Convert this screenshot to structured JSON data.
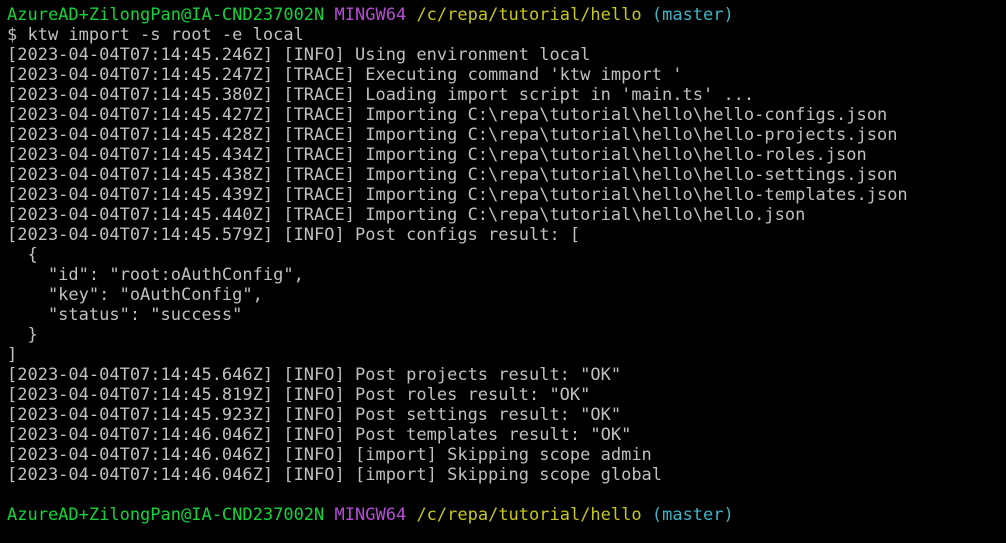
{
  "prompt": {
    "user_host": "AzureAD+ZilongPan@IA-CND237002N",
    "env": "MINGW64",
    "path": "/c/repa/tutorial/hello",
    "branch": "(master)"
  },
  "command": "$ ktw import -s root -e local",
  "output_lines": [
    "[2023-04-04T07:14:45.246Z] [INFO] Using environment local",
    "[2023-04-04T07:14:45.247Z] [TRACE] Executing command 'ktw import '",
    "[2023-04-04T07:14:45.380Z] [TRACE] Loading import script in 'main.ts' ...",
    "[2023-04-04T07:14:45.427Z] [TRACE] Importing C:\\repa\\tutorial\\hello\\hello-configs.json",
    "[2023-04-04T07:14:45.428Z] [TRACE] Importing C:\\repa\\tutorial\\hello\\hello-projects.json",
    "[2023-04-04T07:14:45.434Z] [TRACE] Importing C:\\repa\\tutorial\\hello\\hello-roles.json",
    "[2023-04-04T07:14:45.438Z] [TRACE] Importing C:\\repa\\tutorial\\hello\\hello-settings.json",
    "[2023-04-04T07:14:45.439Z] [TRACE] Importing C:\\repa\\tutorial\\hello\\hello-templates.json",
    "[2023-04-04T07:14:45.440Z] [TRACE] Importing C:\\repa\\tutorial\\hello\\hello.json",
    "[2023-04-04T07:14:45.579Z] [INFO] Post configs result: [",
    "  {",
    "    \"id\": \"root:oAuthConfig\",",
    "    \"key\": \"oAuthConfig\",",
    "    \"status\": \"success\"",
    "  }",
    "]",
    "[2023-04-04T07:14:45.646Z] [INFO] Post projects result: \"OK\"",
    "[2023-04-04T07:14:45.819Z] [INFO] Post roles result: \"OK\"",
    "[2023-04-04T07:14:45.923Z] [INFO] Post settings result: \"OK\"",
    "[2023-04-04T07:14:46.046Z] [INFO] Post templates result: \"OK\"",
    "[2023-04-04T07:14:46.046Z] [INFO] [import] Skipping scope admin",
    "[2023-04-04T07:14:46.046Z] [INFO] [import] Skipping scope global"
  ],
  "final_prompt": {
    "user_host": "AzureAD+ZilongPan@IA-CND237002N",
    "env": "MINGW64",
    "path": "/c/repa/tutorial/hello",
    "branch": "(master)"
  },
  "colors": {
    "background": "#000000",
    "text": "#c0c0c0",
    "user_host": "#13d43a",
    "env": "#b84cd6",
    "path": "#c6c61b",
    "branch": "#3fb4c4"
  }
}
